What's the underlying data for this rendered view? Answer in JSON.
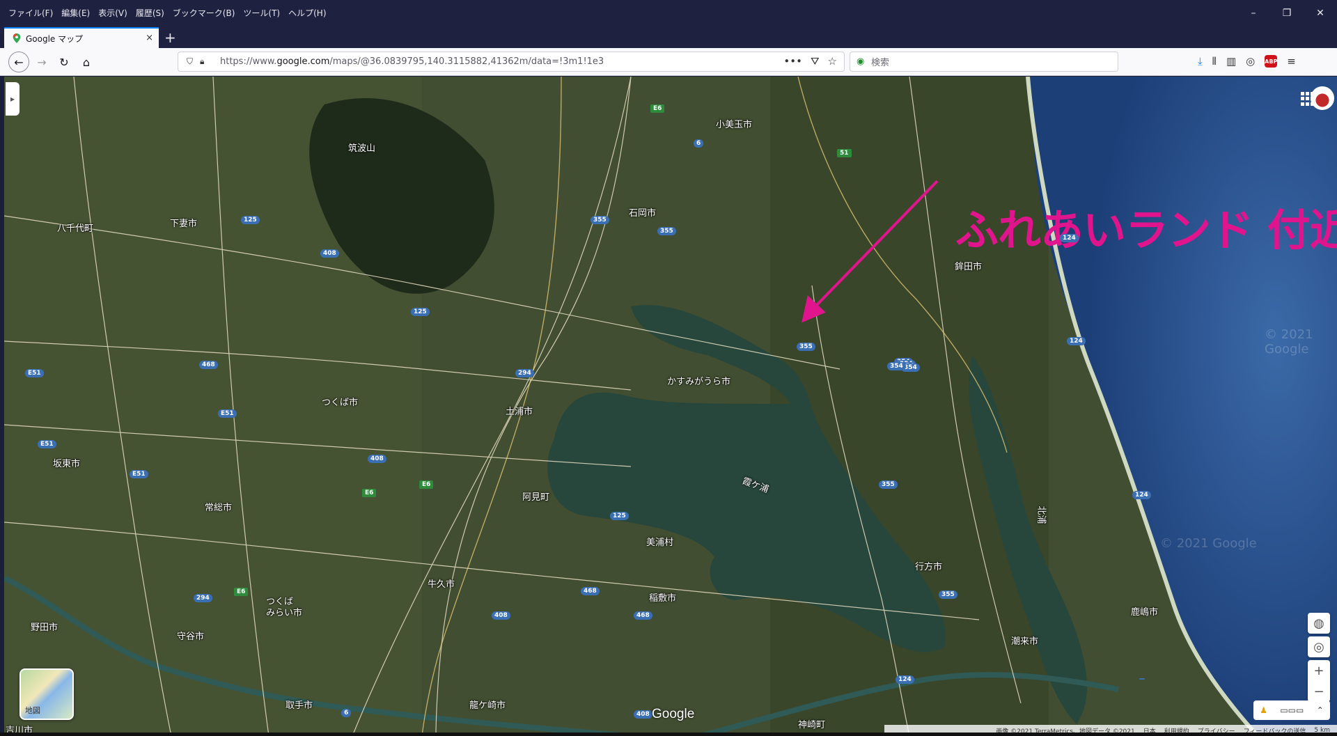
{
  "menu": [
    "ファイル(F)",
    "編集(E)",
    "表示(V)",
    "履歴(S)",
    "ブックマーク(B)",
    "ツール(T)",
    "ヘルプ(H)"
  ],
  "tab": {
    "title": "Google マップ",
    "close": "×",
    "new": "+"
  },
  "url": {
    "prefix": "https://www.",
    "domain": "google.com",
    "rest": "/maps/@36.0839795,140.3115882,41362m/data=!3m1!1e3"
  },
  "search": {
    "placeholder": "検索"
  },
  "annotation": "ふれあいランド 付近",
  "map": {
    "labels": [
      {
        "id": "tsukubasan",
        "text": "筑波山"
      },
      {
        "id": "omitama",
        "text": "小美玉市"
      },
      {
        "id": "ishioka",
        "text": "石岡市"
      },
      {
        "id": "hachichiyo",
        "text": "八千代町"
      },
      {
        "id": "shimotsuma",
        "text": "下妻市"
      },
      {
        "id": "hokota",
        "text": "鉾田市"
      },
      {
        "id": "kasumigaura",
        "text": "かすみがうら市"
      },
      {
        "id": "tsukuba",
        "text": "つくば市"
      },
      {
        "id": "tsuchiura",
        "text": "土浦市"
      },
      {
        "id": "bando",
        "text": "坂東市"
      },
      {
        "id": "kasumigaura_lake",
        "text": "霞ケ浦"
      },
      {
        "id": "ami",
        "text": "阿見町"
      },
      {
        "id": "joso",
        "text": "常総市"
      },
      {
        "id": "miho",
        "text": "美浦村"
      },
      {
        "id": "kitaura",
        "text": "北浦"
      },
      {
        "id": "namegata",
        "text": "行方市"
      },
      {
        "id": "ushiku",
        "text": "牛久市"
      },
      {
        "id": "inashiki",
        "text": "稲敷市"
      },
      {
        "id": "tsukubamirai",
        "text": "つくば\nみらい市"
      },
      {
        "id": "noda",
        "text": "野田市"
      },
      {
        "id": "moriya",
        "text": "守谷市"
      },
      {
        "id": "kashima",
        "text": "鹿嶋市"
      },
      {
        "id": "itako",
        "text": "潮来市"
      },
      {
        "id": "toride",
        "text": "取手市"
      },
      {
        "id": "ryugasaki",
        "text": "龍ケ崎市"
      },
      {
        "id": "kozaki",
        "text": "神崎町"
      },
      {
        "id": "yoshikawa",
        "text": "吉川市"
      }
    ],
    "shields": [
      "E6",
      "6",
      "355",
      "125",
      "408",
      "354",
      "294",
      "468",
      "E51",
      "51",
      "124"
    ],
    "layer_thumb_label": "地図",
    "google_logo": "Google",
    "attribution": [
      "画像 ©2021 TerraMetrics、地図データ ©2021",
      "日本",
      "利用規約",
      "プライバシー",
      "フィードバックの送信",
      "5 km"
    ],
    "watermark": "© 2021 Google",
    "zoom_in": "+",
    "zoom_out": "−"
  }
}
